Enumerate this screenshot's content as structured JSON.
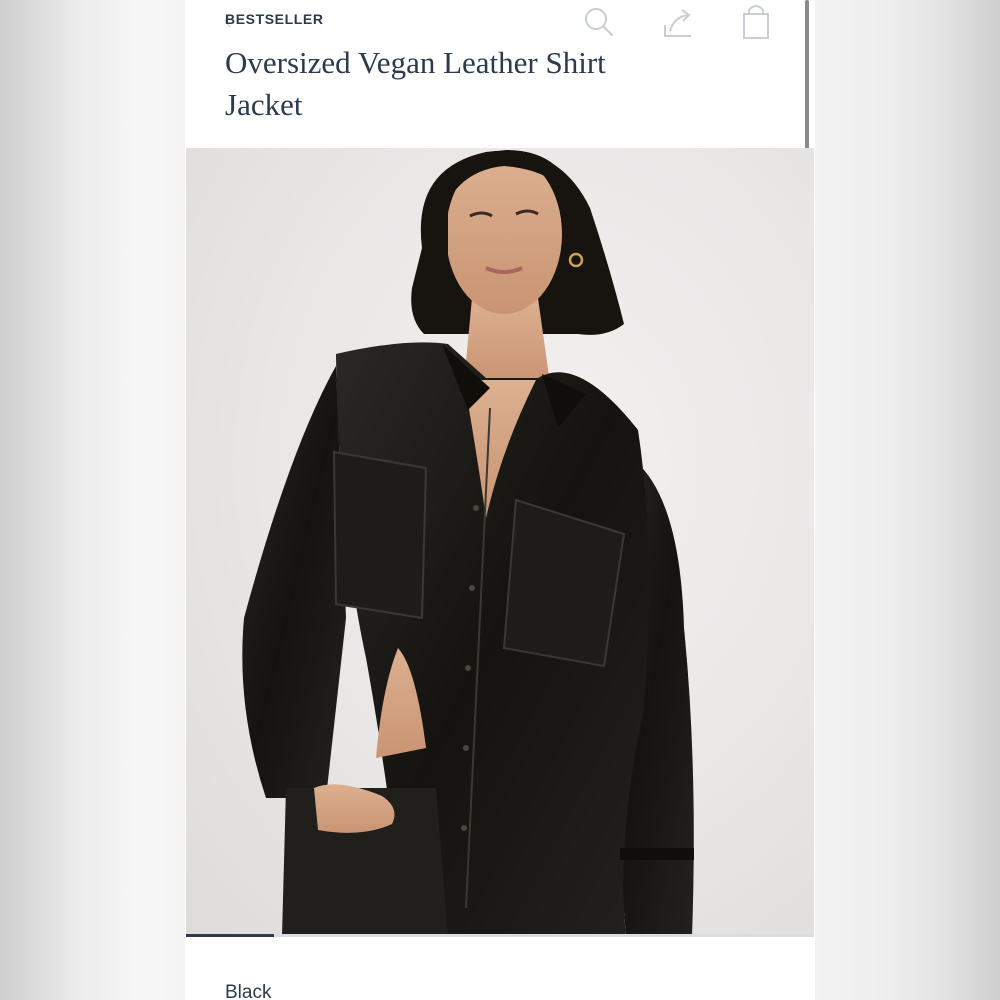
{
  "header": {
    "badge": "BESTSELLER",
    "title": "Oversized Vegan Leather Shirt Jacket"
  },
  "icons": {
    "back": "chevron-left-icon",
    "search": "search-icon",
    "share": "share-icon",
    "bag": "shopping-bag-icon"
  },
  "gallery": {
    "progress": 0.14
  },
  "product": {
    "color": "Black"
  },
  "colors": {
    "text": "#2c3a4b",
    "icon": "#c9ced4",
    "jacket": "#1b1a17"
  }
}
